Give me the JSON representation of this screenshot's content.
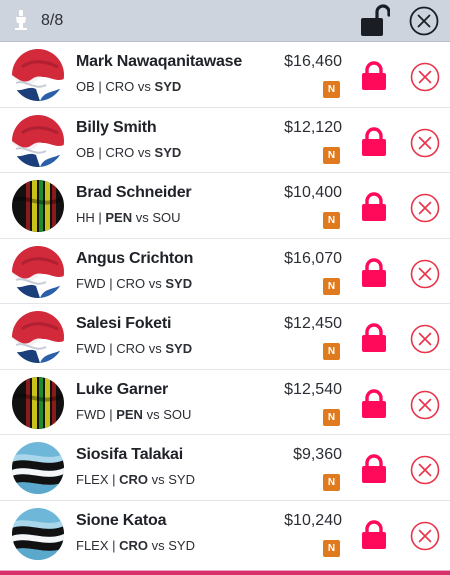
{
  "header": {
    "count": "8/8",
    "icons": {
      "lineup": "lineup-icon",
      "unlock": "unlock-icon",
      "close": "close-circle-icon"
    }
  },
  "colors": {
    "header_bg": "#cdd4de",
    "lock": "#ff0a5a",
    "remove": "#e8344a",
    "badge": "#e07a1f",
    "accent_line": "#d8306b"
  },
  "players": [
    {
      "name": "Mark Nawaqanitawase",
      "pos": "OB",
      "team": "CRO",
      "vs": "vs",
      "opp": "SYD",
      "bold": "opp",
      "price": "$16,460",
      "badge": "N",
      "jersey": "roosters"
    },
    {
      "name": "Billy Smith",
      "pos": "OB",
      "team": "CRO",
      "vs": "vs",
      "opp": "SYD",
      "bold": "opp",
      "price": "$12,120",
      "badge": "N",
      "jersey": "roosters"
    },
    {
      "name": "Brad Schneider",
      "pos": "HH",
      "team": "PEN",
      "vs": "vs",
      "opp": "SOU",
      "bold": "team",
      "price": "$10,400",
      "badge": "N",
      "jersey": "panthers"
    },
    {
      "name": "Angus Crichton",
      "pos": "FWD",
      "team": "CRO",
      "vs": "vs",
      "opp": "SYD",
      "bold": "opp",
      "price": "$16,070",
      "badge": "N",
      "jersey": "roosters"
    },
    {
      "name": "Salesi Foketi",
      "pos": "FWD",
      "team": "CRO",
      "vs": "vs",
      "opp": "SYD",
      "bold": "opp",
      "price": "$12,450",
      "badge": "N",
      "jersey": "roosters"
    },
    {
      "name": "Luke Garner",
      "pos": "FWD",
      "team": "PEN",
      "vs": "vs",
      "opp": "SOU",
      "bold": "team",
      "price": "$12,540",
      "badge": "N",
      "jersey": "panthers"
    },
    {
      "name": "Siosifa Talakai",
      "pos": "FLEX",
      "team": "CRO",
      "vs": "vs",
      "opp": "SYD",
      "bold": "team",
      "price": "$9,360",
      "badge": "N",
      "jersey": "sharks"
    },
    {
      "name": "Sione Katoa",
      "pos": "FLEX",
      "team": "CRO",
      "vs": "vs",
      "opp": "SYD",
      "bold": "team",
      "price": "$10,240",
      "badge": "N",
      "jersey": "sharks"
    }
  ]
}
